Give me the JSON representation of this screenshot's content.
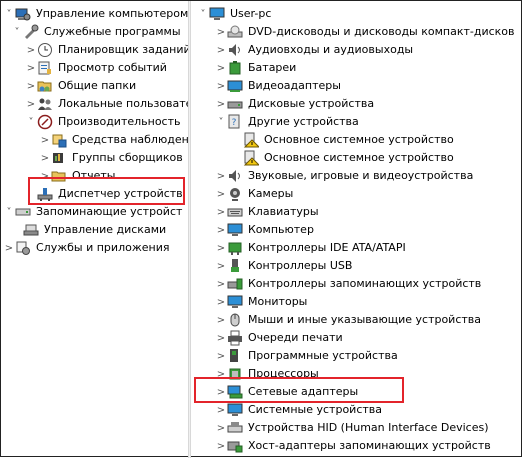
{
  "left_tree": [
    {
      "label": "Управление компьютером (л",
      "arrow": "˅",
      "icon": "computer-management-icon"
    },
    {
      "label": "Служебные программы",
      "arrow": "˅",
      "icon": "tools-icon"
    },
    {
      "label": "Планировщик заданий",
      "arrow": ">",
      "icon": "clock-icon"
    },
    {
      "label": "Просмотр событий",
      "arrow": ">",
      "icon": "event-viewer-icon"
    },
    {
      "label": "Общие папки",
      "arrow": ">",
      "icon": "shared-folder-icon"
    },
    {
      "label": "Локальные пользовате",
      "arrow": ">",
      "icon": "users-icon"
    },
    {
      "label": "Производительность",
      "arrow": "˅",
      "icon": "performance-icon"
    },
    {
      "label": "Средства наблюден",
      "arrow": ">",
      "icon": "monitor-tool-icon"
    },
    {
      "label": "Группы сборщиков",
      "arrow": ">",
      "icon": "collector-icon"
    },
    {
      "label": "Отчеты",
      "arrow": ">",
      "icon": "reports-icon"
    },
    {
      "label": "Диспетчер устройств",
      "arrow": "",
      "icon": "device-manager-icon"
    },
    {
      "label": "Запоминающие устройст",
      "arrow": "˅",
      "icon": "storage-icon"
    },
    {
      "label": "Управление дисками",
      "arrow": "",
      "icon": "disk-management-icon"
    },
    {
      "label": "Службы и приложения",
      "arrow": ">",
      "icon": "services-icon"
    }
  ],
  "right_tree": [
    {
      "label": "User-pc",
      "arrow": "˅",
      "icon": "computer-icon"
    },
    {
      "label": "DVD-дисководы и дисководы компакт-дисков",
      "arrow": ">",
      "icon": "dvd-drive-icon"
    },
    {
      "label": "Аудиовходы и аудиовыходы",
      "arrow": ">",
      "icon": "speaker-icon"
    },
    {
      "label": "Батареи",
      "arrow": ">",
      "icon": "battery-icon"
    },
    {
      "label": "Видеоадаптеры",
      "arrow": ">",
      "icon": "display-adapter-icon"
    },
    {
      "label": "Дисковые устройства",
      "arrow": ">",
      "icon": "disk-drive-icon"
    },
    {
      "label": "Другие устройства",
      "arrow": "˅",
      "icon": "other-devices-icon"
    },
    {
      "label": "Основное системное устройство",
      "arrow": "",
      "icon": "warning-device-icon"
    },
    {
      "label": "Основное системное устройство",
      "arrow": "",
      "icon": "warning-device-icon"
    },
    {
      "label": "Звуковые, игровые и видеоустройства",
      "arrow": ">",
      "icon": "sound-icon"
    },
    {
      "label": "Камеры",
      "arrow": ">",
      "icon": "camera-icon"
    },
    {
      "label": "Клавиатуры",
      "arrow": ">",
      "icon": "keyboard-icon"
    },
    {
      "label": "Компьютер",
      "arrow": ">",
      "icon": "monitor-icon"
    },
    {
      "label": "Контроллеры IDE ATA/ATAPI",
      "arrow": ">",
      "icon": "ide-controller-icon"
    },
    {
      "label": "Контроллеры USB",
      "arrow": ">",
      "icon": "usb-icon"
    },
    {
      "label": "Контроллеры запоминающих устройств",
      "arrow": ">",
      "icon": "storage-controller-icon"
    },
    {
      "label": "Мониторы",
      "arrow": ">",
      "icon": "monitor-icon"
    },
    {
      "label": "Мыши и иные указывающие устройства",
      "arrow": ">",
      "icon": "mouse-icon"
    },
    {
      "label": "Очереди печати",
      "arrow": ">",
      "icon": "printer-icon"
    },
    {
      "label": "Программные устройства",
      "arrow": ">",
      "icon": "software-device-icon"
    },
    {
      "label": "Процессоры",
      "arrow": ">",
      "icon": "processor-icon"
    },
    {
      "label": "Сетевые адаптеры",
      "arrow": ">",
      "icon": "network-adapter-icon"
    },
    {
      "label": "Системные устройства",
      "arrow": ">",
      "icon": "system-device-icon"
    },
    {
      "label": "Устройства HID (Human Interface Devices)",
      "arrow": ">",
      "icon": "hid-icon"
    },
    {
      "label": "Хост-адаптеры запоминающих устройств",
      "arrow": ">",
      "icon": "storage-host-icon"
    }
  ],
  "colors": {
    "highlight": "#e3242b",
    "arrow": "#555555"
  }
}
